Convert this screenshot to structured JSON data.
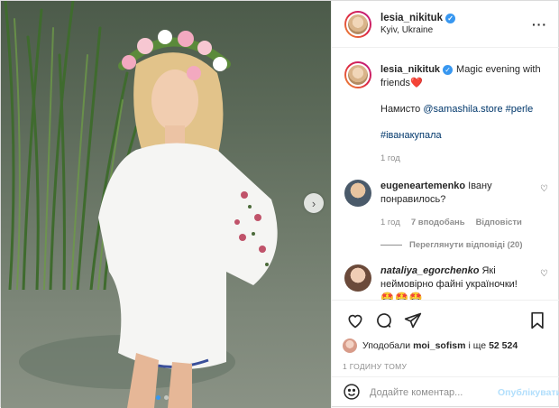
{
  "post": {
    "username": "lesia_nikituk",
    "location": "Kyiv, Ukraine",
    "caption_line1": "Magic evening with",
    "caption_line2": "friends",
    "caption_emoji": "❤️",
    "necklace_prefix": "Намисто",
    "necklace_mention": "@samashila.store",
    "necklace_tag": "#perle",
    "hashtag": "#іванакупала",
    "caption_time": "1 год"
  },
  "comments": [
    {
      "username": "eugeneartemenko",
      "text_line1": "Івану",
      "text_line2": "понравилось?",
      "time": "1 год",
      "likes": "7 вподобань",
      "reply": "Відповісти",
      "view_replies": "Переглянути відповіді (20)"
    },
    {
      "username": "nataliya_egorchenko",
      "text_line1": "Які",
      "text_line2": "неймовірно файні україночки!",
      "emojis": "🤩🤩🤩"
    }
  ],
  "likes_summary": {
    "prefix": "Уподобали",
    "user": "moi_sofism",
    "middle": "і ще",
    "count": "52 524"
  },
  "timestamp": "1 ГОДИНУ ТОМУ",
  "comment_input": {
    "placeholder": "Додайте коментар...",
    "publish_label": "Опублікувати"
  },
  "icons": [
    "heart-icon",
    "comment-icon",
    "share-icon",
    "bookmark-icon",
    "emoji-icon",
    "more-icon",
    "verified-icon",
    "chevron-right-icon"
  ],
  "colors": {
    "link": "#00376b",
    "verified": "#3897f0",
    "publish_disabled": "#b2dffc",
    "muted": "#8e8e8e"
  }
}
